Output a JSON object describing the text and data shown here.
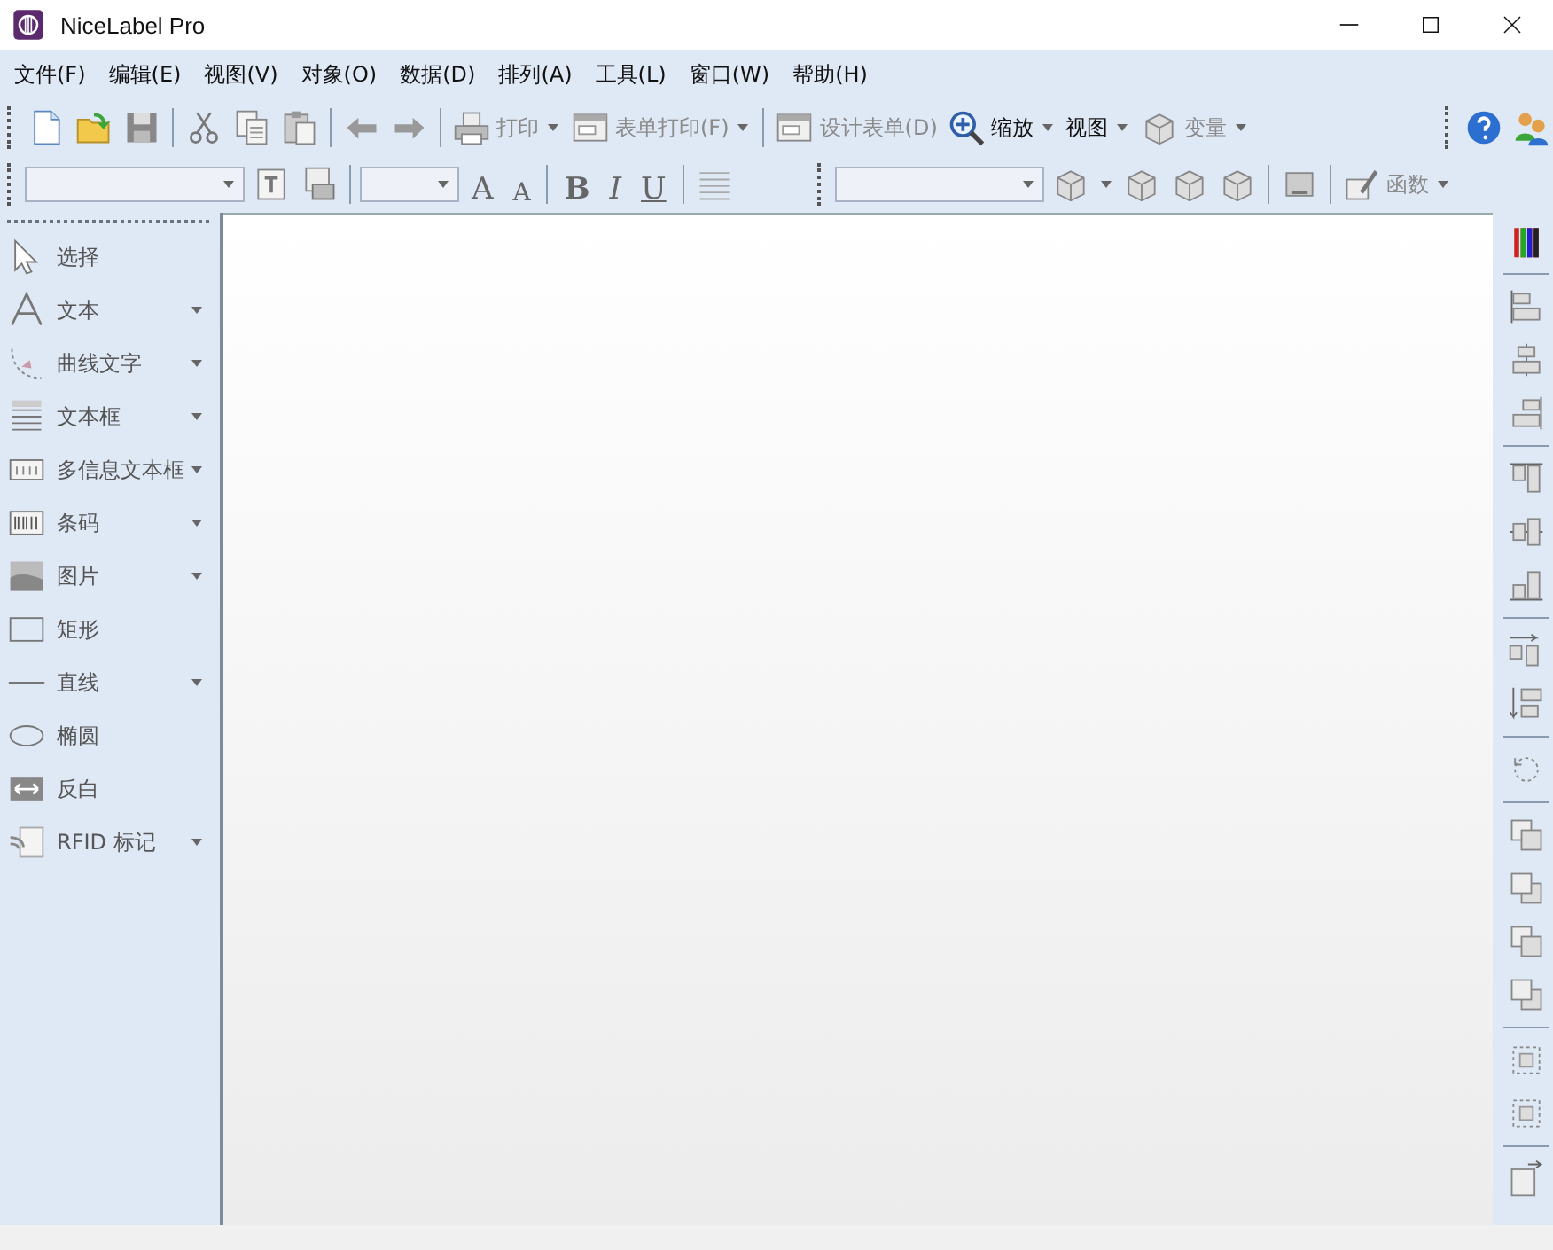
{
  "window": {
    "title": "NiceLabel Pro"
  },
  "menu": [
    "文件(F)",
    "编辑(E)",
    "视图(V)",
    "对象(O)",
    "数据(D)",
    "排列(A)",
    "工具(L)",
    "窗口(W)",
    "帮助(H)"
  ],
  "toolbar": {
    "buttons": [
      {
        "label": "打印",
        "disabled": true,
        "dropdown": true
      },
      {
        "label": "表单打印(F)",
        "disabled": true,
        "dropdown": true
      },
      {
        "label": "设计表单(D)",
        "disabled": true,
        "dropdown": false
      },
      {
        "label": "缩放",
        "disabled": false,
        "dropdown": true
      },
      {
        "label": "视图",
        "disabled": false,
        "dropdown": true
      },
      {
        "label": "变量",
        "disabled": true,
        "dropdown": true
      }
    ]
  },
  "format_bar": {
    "grow_font": "A",
    "shrink_font": "A",
    "styles": [
      "B",
      "I",
      "U"
    ],
    "function_button": {
      "label": "函数",
      "disabled": true,
      "dropdown": true
    }
  },
  "tools": [
    {
      "label": "选择",
      "dropdown": false
    },
    {
      "label": "文本",
      "dropdown": true
    },
    {
      "label": "曲线文字",
      "dropdown": true
    },
    {
      "label": "文本框",
      "dropdown": true
    },
    {
      "label": "多信息文本框",
      "dropdown": true
    },
    {
      "label": "条码",
      "dropdown": true
    },
    {
      "label": "图片",
      "dropdown": true
    },
    {
      "label": "矩形",
      "dropdown": false
    },
    {
      "label": "直线",
      "dropdown": true
    },
    {
      "label": "椭圆",
      "dropdown": false
    },
    {
      "label": "反白",
      "dropdown": false
    },
    {
      "label": "RFID 标记",
      "dropdown": true
    }
  ]
}
